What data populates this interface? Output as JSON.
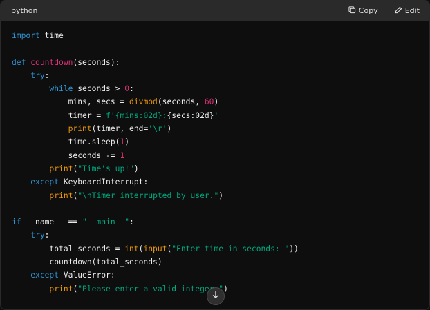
{
  "header": {
    "language": "python",
    "copy_label": "Copy",
    "edit_label": "Edit"
  },
  "icons": {
    "copy": "copy-icon",
    "edit": "pencil-icon",
    "scroll": "arrow-down-icon"
  },
  "colors": {
    "keyword": "#2e95d3",
    "function_name": "#df3079",
    "builtin": "#e9950c",
    "number": "#df3079",
    "string": "#00a67d",
    "text": "#ececec",
    "header_bg": "#2a2a2a",
    "code_bg": "#0e0e0e"
  },
  "code_lines": [
    [
      {
        "t": "import",
        "c": "kw"
      },
      {
        "t": " time",
        "c": "plain"
      }
    ],
    [],
    [
      {
        "t": "def",
        "c": "kw"
      },
      {
        "t": " ",
        "c": "plain"
      },
      {
        "t": "countdown",
        "c": "fn"
      },
      {
        "t": "(seconds):",
        "c": "plain"
      }
    ],
    [
      {
        "t": "    ",
        "c": "plain"
      },
      {
        "t": "try",
        "c": "kw"
      },
      {
        "t": ":",
        "c": "plain"
      }
    ],
    [
      {
        "t": "        ",
        "c": "plain"
      },
      {
        "t": "while",
        "c": "kw"
      },
      {
        "t": " seconds > ",
        "c": "plain"
      },
      {
        "t": "0",
        "c": "num"
      },
      {
        "t": ":",
        "c": "plain"
      }
    ],
    [
      {
        "t": "            mins, secs = ",
        "c": "plain"
      },
      {
        "t": "divmod",
        "c": "bi"
      },
      {
        "t": "(seconds, ",
        "c": "plain"
      },
      {
        "t": "60",
        "c": "num"
      },
      {
        "t": ")",
        "c": "plain"
      }
    ],
    [
      {
        "t": "            timer = ",
        "c": "plain"
      },
      {
        "t": "f'",
        "c": "str"
      },
      {
        "t": "{mins:02d}",
        "c": "str"
      },
      {
        "t": ":",
        "c": "str"
      },
      {
        "t": "{secs:02d}",
        "c": "plain"
      },
      {
        "t": "'",
        "c": "str"
      }
    ],
    [
      {
        "t": "            ",
        "c": "plain"
      },
      {
        "t": "print",
        "c": "bi"
      },
      {
        "t": "(timer, end=",
        "c": "plain"
      },
      {
        "t": "'\\r'",
        "c": "str"
      },
      {
        "t": ")",
        "c": "plain"
      }
    ],
    [
      {
        "t": "            time.sleep(",
        "c": "plain"
      },
      {
        "t": "1",
        "c": "num"
      },
      {
        "t": ")",
        "c": "plain"
      }
    ],
    [
      {
        "t": "            seconds -= ",
        "c": "plain"
      },
      {
        "t": "1",
        "c": "num"
      }
    ],
    [
      {
        "t": "        ",
        "c": "plain"
      },
      {
        "t": "print",
        "c": "bi"
      },
      {
        "t": "(",
        "c": "plain"
      },
      {
        "t": "\"Time's up!\"",
        "c": "str"
      },
      {
        "t": ")",
        "c": "plain"
      }
    ],
    [
      {
        "t": "    ",
        "c": "plain"
      },
      {
        "t": "except",
        "c": "kw"
      },
      {
        "t": " KeyboardInterrupt:",
        "c": "plain"
      }
    ],
    [
      {
        "t": "        ",
        "c": "plain"
      },
      {
        "t": "print",
        "c": "bi"
      },
      {
        "t": "(",
        "c": "plain"
      },
      {
        "t": "\"\\nTimer interrupted by user.\"",
        "c": "str"
      },
      {
        "t": ")",
        "c": "plain"
      }
    ],
    [],
    [
      {
        "t": "if",
        "c": "kw"
      },
      {
        "t": " __name__ == ",
        "c": "plain"
      },
      {
        "t": "\"__main__\"",
        "c": "str"
      },
      {
        "t": ":",
        "c": "plain"
      }
    ],
    [
      {
        "t": "    ",
        "c": "plain"
      },
      {
        "t": "try",
        "c": "kw"
      },
      {
        "t": ":",
        "c": "plain"
      }
    ],
    [
      {
        "t": "        total_seconds = ",
        "c": "plain"
      },
      {
        "t": "int",
        "c": "bi"
      },
      {
        "t": "(",
        "c": "plain"
      },
      {
        "t": "input",
        "c": "bi"
      },
      {
        "t": "(",
        "c": "plain"
      },
      {
        "t": "\"Enter time in seconds: \"",
        "c": "str"
      },
      {
        "t": "))",
        "c": "plain"
      }
    ],
    [
      {
        "t": "        countdown(total_seconds)",
        "c": "plain"
      }
    ],
    [
      {
        "t": "    ",
        "c": "plain"
      },
      {
        "t": "except",
        "c": "kw"
      },
      {
        "t": " ValueError:",
        "c": "plain"
      }
    ],
    [
      {
        "t": "        ",
        "c": "plain"
      },
      {
        "t": "print",
        "c": "bi"
      },
      {
        "t": "(",
        "c": "plain"
      },
      {
        "t": "\"Please enter a valid integer.\"",
        "c": "str"
      },
      {
        "t": ")",
        "c": "plain"
      }
    ]
  ]
}
